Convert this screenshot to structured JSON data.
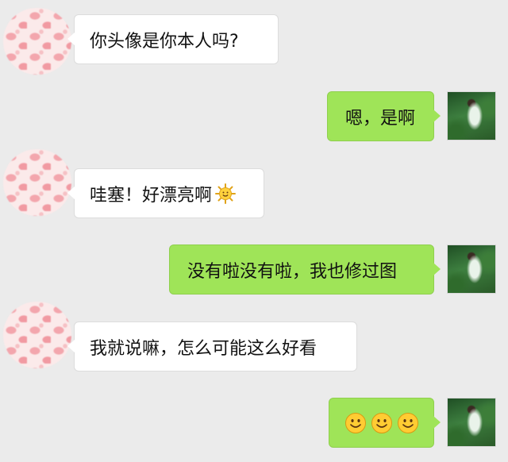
{
  "messages": [
    {
      "side": "in",
      "text": "你头像是你本人吗?"
    },
    {
      "side": "out",
      "text": "嗯，是啊"
    },
    {
      "side": "in",
      "text": "哇塞！好漂亮啊",
      "emoji": "sun-emoji"
    },
    {
      "side": "out",
      "text": "没有啦没有啦，我也修过图"
    },
    {
      "side": "in",
      "text": "我就说嘛，怎么可能这么好看"
    },
    {
      "side": "out",
      "text": "",
      "emoji": [
        "smiley-emoji",
        "smiley-emoji",
        "smiley-emoji"
      ]
    }
  ],
  "colors": {
    "background": "#ebebeb",
    "incoming_bubble": "#ffffff",
    "outgoing_bubble": "#9fe458",
    "text": "#111111"
  },
  "icons": {
    "left_avatar": "pink-hearts-avatar",
    "right_avatar": "girl-in-forest-avatar"
  }
}
